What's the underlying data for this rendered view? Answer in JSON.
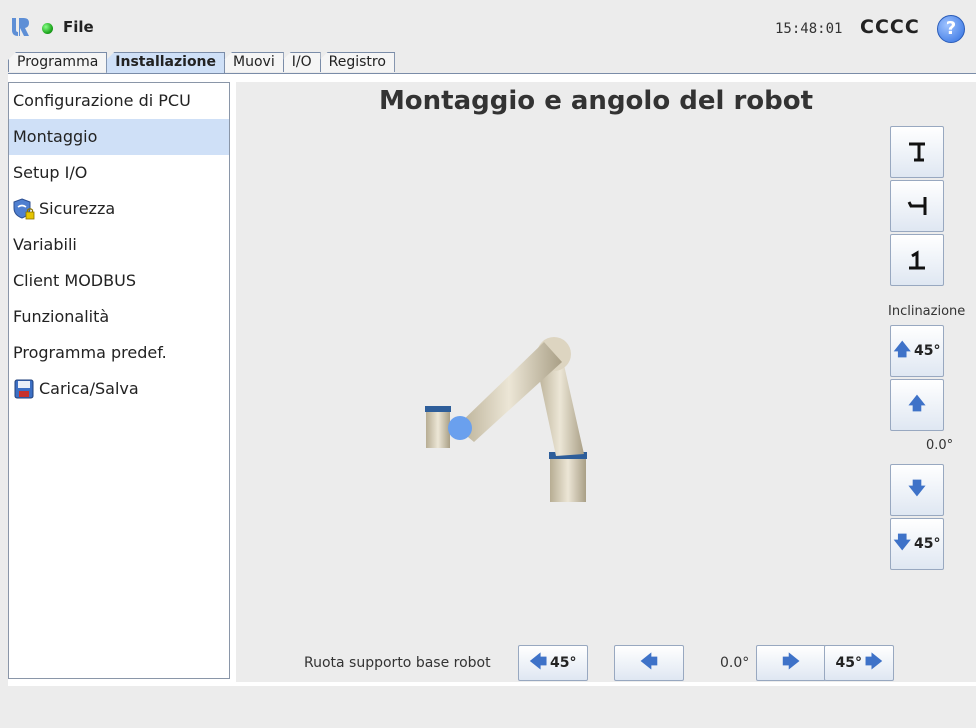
{
  "header": {
    "file_label": "File",
    "time": "15:48:01",
    "robot_name": "CCCC",
    "help_label": "?"
  },
  "tabs": [
    {
      "label": "Programma",
      "active": false
    },
    {
      "label": "Installazione",
      "active": true
    },
    {
      "label": "Muovi",
      "active": false
    },
    {
      "label": "I/O",
      "active": false
    },
    {
      "label": "Registro",
      "active": false
    }
  ],
  "sidebar": {
    "items": [
      {
        "label": "Configurazione di PCU"
      },
      {
        "label": "Montaggio",
        "selected": true
      },
      {
        "label": "Setup I/O"
      },
      {
        "label": "Sicurezza",
        "icon": "shield-lock-icon"
      },
      {
        "label": "Variabili"
      },
      {
        "label": "Client MODBUS"
      },
      {
        "label": "Funzionalità"
      },
      {
        "label": "Programma predef."
      },
      {
        "label": "Carica/Salva",
        "icon": "floppy-disk-icon"
      }
    ]
  },
  "main": {
    "title": "Montaggio e angolo del robot",
    "view_buttons": [
      "floor-mount-icon",
      "wall-mount-icon",
      "ceiling-mount-icon"
    ],
    "tilt": {
      "label": "Inclinazione",
      "up45_label": "45°",
      "down45_label": "45°",
      "value": "0.0°"
    },
    "rotate": {
      "label": "Ruota supporto base robot",
      "left45_label": "45°",
      "right45_label": "45°",
      "value": "0.0°"
    }
  },
  "colors": {
    "accent": "#cfe0f7",
    "arrow": "#3e72c8",
    "status_ok": "#2a2"
  }
}
